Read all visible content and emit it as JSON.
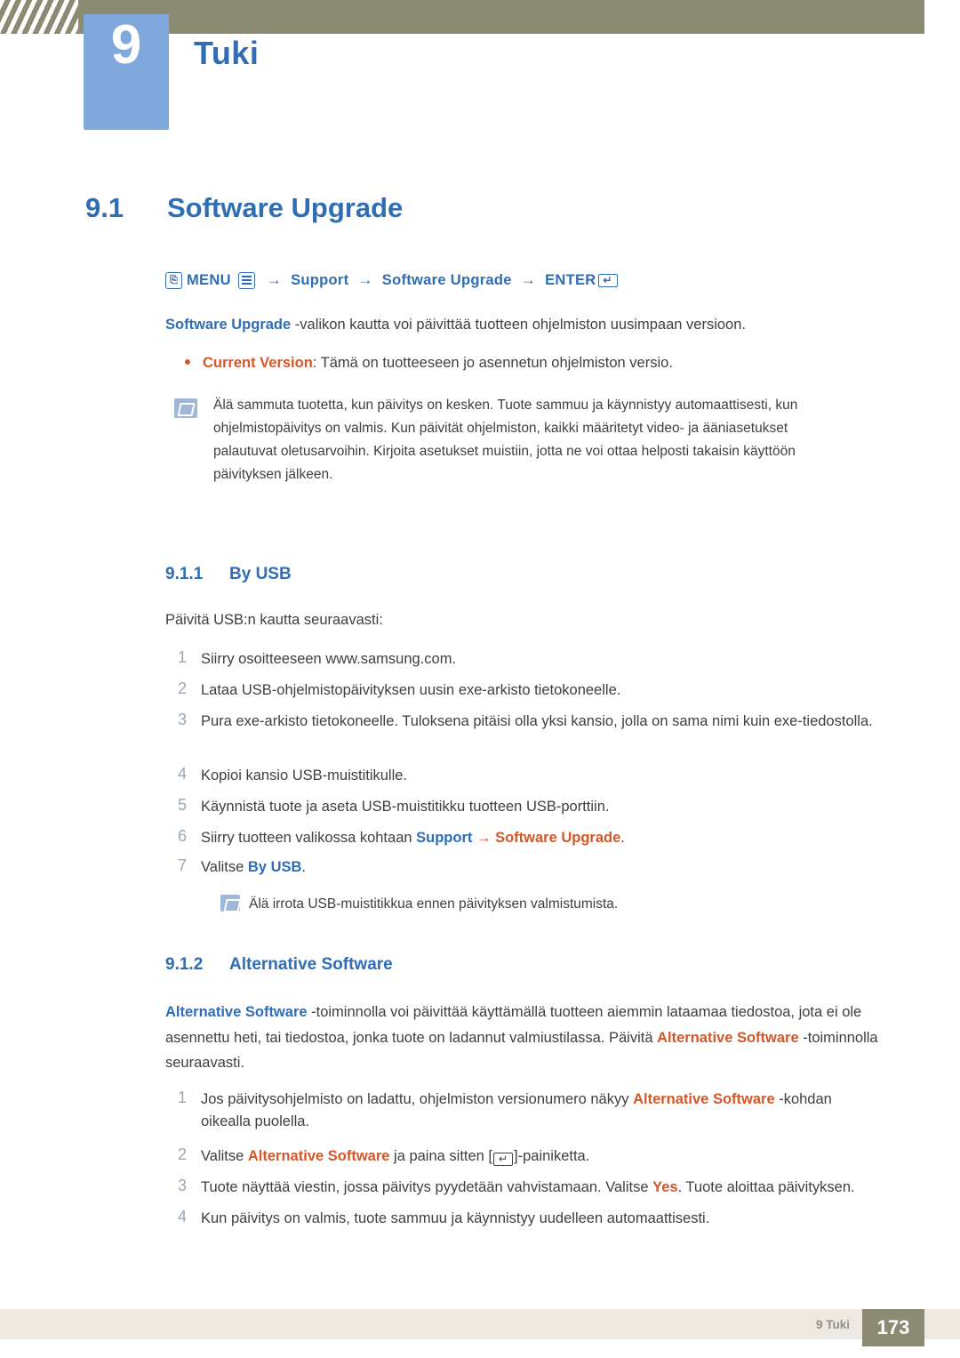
{
  "header": {
    "chapter_number": "9",
    "chapter_title": "Tuki"
  },
  "section": {
    "number": "9.1",
    "title": "Software Upgrade"
  },
  "menu_path": {
    "menu_label": "MENU",
    "item1": "Support",
    "item2": "Software Upgrade",
    "enter_label": "ENTER",
    "arrow": "→"
  },
  "intro": {
    "bold": "Software Upgrade",
    "rest": " -valikon kautta voi päivittää tuotteen ohjelmiston uusimpaan versioon."
  },
  "bullet": {
    "bold": "Current Version",
    "rest": ": Tämä on tuotteeseen jo asennetun ohjelmiston versio."
  },
  "note1": {
    "text": "Älä sammuta tuotetta, kun päivitys on kesken. Tuote sammuu ja käynnistyy automaattisesti, kun ohjelmistopäivitys on valmis. Kun päivität ohjelmiston, kaikki määritetyt video- ja ääniasetukset palautuvat oletusarvoihin. Kirjoita asetukset muistiin, jotta ne voi ottaa helposti takaisin käyttöön päivityksen jälkeen."
  },
  "subsection1": {
    "number": "9.1.1",
    "title": "By USB",
    "lead": "Päivitä USB:n kautta seuraavasti:",
    "steps": [
      {
        "num": "1",
        "text": "Siirry osoitteeseen www.samsung.com."
      },
      {
        "num": "2",
        "text": "Lataa USB-ohjelmistopäivityksen uusin exe-arkisto tietokoneelle."
      },
      {
        "num": "3",
        "text": "Pura exe-arkisto tietokoneelle. Tuloksena pitäisi olla yksi kansio, jolla on sama nimi kuin exe-tiedostolla."
      },
      {
        "num": "4",
        "text": "Kopioi kansio USB-muistitikulle."
      },
      {
        "num": "5",
        "text": "Käynnistä tuote ja aseta USB-muistitikku tuotteen USB-porttiin."
      },
      {
        "num": "6",
        "text": "Siirry tuotteen valikossa kohtaan Support → Software Upgrade."
      },
      {
        "num": "7",
        "text": "Valitse By USB."
      }
    ],
    "step6_plain_prefix": "Siirry tuotteen valikossa kohtaan ",
    "step6_bold1": "Support",
    "step6_arrow": "→",
    "step6_bold2": "Software Upgrade",
    "step6_suffix": ".",
    "step7_prefix": "Valitse ",
    "step7_bold": "By USB",
    "step7_suffix": ".",
    "note": "Älä irrota USB-muistitikkua ennen päivityksen valmistumista."
  },
  "subsection2": {
    "number": "9.1.2",
    "title": "Alternative Software",
    "intro_bold1": "Alternative Software",
    "intro_part1": " -toiminnolla voi päivittää käyttämällä tuotteen aiemmin lataamaa tiedostoa, jota ei ole asennettu heti, tai tiedostoa, jonka tuote on ladannut valmiustilassa. Päivitä ",
    "intro_bold2": "Alternative Software",
    "intro_part2": " -toiminnolla seuraavasti.",
    "steps": [
      {
        "num": "1",
        "text": "Jos päivitysohjelmisto on ladattu, ohjelmiston versionumero näkyy Alternative Software -kohdan oikealla puolella."
      },
      {
        "num": "2",
        "text": "Valitse Alternative Software ja paina sitten [ ]-painiketta."
      },
      {
        "num": "3",
        "text": "Tuote näyttää viestin, jossa päivitys pyydetään vahvistamaan. Valitse Yes. Tuote aloittaa päivityksen."
      },
      {
        "num": "4",
        "text": "Kun päivitys on valmis, tuote sammuu ja käynnistyy uudelleen automaattisesti."
      }
    ],
    "step1_prefix": "Jos päivitysohjelmisto on ladattu, ohjelmiston versionumero näkyy ",
    "step1_bold": "Alternative Software",
    "step1_suffix": " -kohdan",
    "step1_line2": "oikealla puolella.",
    "step2_prefix": "Valitse ",
    "step2_bold": "Alternative Software",
    "step2_mid": " ja paina sitten [",
    "step2_suffix": "]-painiketta.",
    "step3_prefix": "Tuote näyttää viestin, jossa päivitys pyydetään vahvistamaan. Valitse ",
    "step3_bold": "Yes",
    "step3_suffix": ". Tuote aloittaa päivityksen.",
    "step4_text": "Kun päivitys on valmis, tuote sammuu ja käynnistyy uudelleen automaattisesti."
  },
  "footer": {
    "label": "9 Tuki",
    "page": "173"
  },
  "colors": {
    "header_band": "#8a8b72",
    "accent_blue": "#2f6db5",
    "badge_blue": "#7fa8dd",
    "accent_orange": "#d2582a",
    "footer_bar": "#ede9e1"
  }
}
